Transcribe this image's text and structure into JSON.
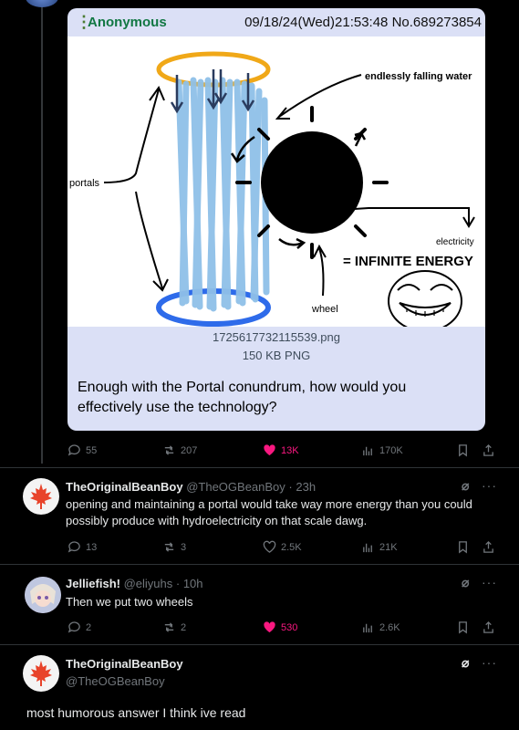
{
  "quoted_post": {
    "poster_name": "Anonymous",
    "post_meta": "09/18/24(Wed)21:53:48 No.689273854",
    "image": {
      "labels": {
        "falling_water": "endlessly falling water",
        "portals": "portals",
        "electricity": "electricity",
        "infinite_energy": "= INFINITE ENERGY",
        "wheel": "wheel"
      },
      "filename": "1725617732115539.png",
      "filesize": "150 KB PNG"
    },
    "question": "Enough with the Portal conundrum, how would you effectively use the technology?"
  },
  "main_actions": {
    "replies": "55",
    "reposts": "207",
    "likes": "13K",
    "views": "170K"
  },
  "replies": [
    {
      "display_name": "TheOriginalBeanBoy",
      "handle": "@TheOGBeanBoy",
      "time": "· 23h",
      "text": "opening and maintaining a portal would take way more energy than you could possibly produce with hydroelectricity on that scale dawg.",
      "counts": {
        "replies": "13",
        "reposts": "3",
        "likes": "2.5K",
        "views": "21K"
      }
    },
    {
      "display_name": "Jelliefish!",
      "handle": "@eliyuhs",
      "time": "· 10h",
      "text": "Then we put two wheels",
      "counts": {
        "replies": "2",
        "reposts": "2",
        "likes": "530",
        "views": "2.6K"
      }
    },
    {
      "display_name": "TheOriginalBeanBoy",
      "handle": "@TheOGBeanBoy",
      "text": "most humorous answer I think ive read"
    }
  ],
  "colors": {
    "like_active": "#f91880",
    "muted": "#71767b",
    "anon_green": "#117743",
    "card_bg": "#dbe0f6"
  },
  "icons": [
    "reply-icon",
    "repost-icon",
    "heart-icon",
    "views-icon",
    "bookmark-icon",
    "share-icon",
    "grok-icon",
    "more-icon",
    "maple-leaf-icon"
  ]
}
